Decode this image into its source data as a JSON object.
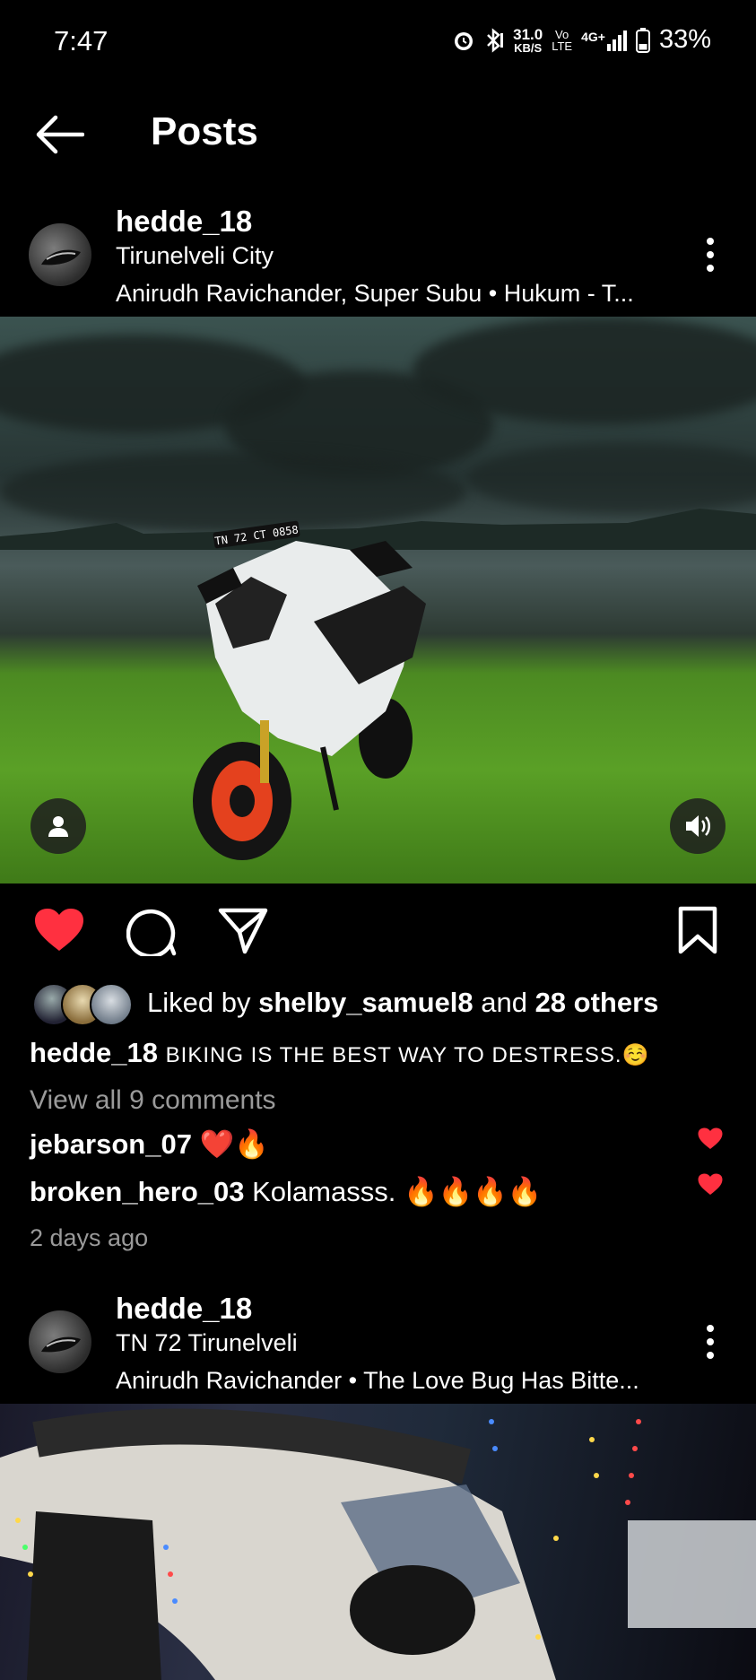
{
  "status": {
    "time": "7:47",
    "speed_value": "31.0",
    "speed_unit": "KB/S",
    "volte_top": "Vo",
    "volte_bottom": "LTE",
    "network": "4G+",
    "battery": "33%"
  },
  "header": {
    "title": "Posts"
  },
  "posts": [
    {
      "username": "hedde_18",
      "location": "Tirunelveli City",
      "audio": "Anirudh Ravichander, Super Subu • Hukum - T...",
      "liked_by_prefix": "Liked by ",
      "liked_by_user": "shelby_samuel8",
      "liked_by_and": " and ",
      "liked_by_others": "28 others",
      "caption_user": "hedde_18",
      "caption_text": "BIKING IS THE BEST WAY TO DESTRESS.☺️",
      "view_comments": "View all 9 comments",
      "comments": [
        {
          "user": "jebarson_07",
          "text": "❤️🔥"
        },
        {
          "user": "broken_hero_03",
          "text": "Kolamasss. 🔥🔥🔥🔥"
        }
      ],
      "time_ago": "2 days ago",
      "plate": "TN 72 CT 0858"
    },
    {
      "username": "hedde_18",
      "location": "TN 72 Tirunelveli",
      "audio": "Anirudh Ravichander • The Love Bug Has Bitte..."
    }
  ],
  "colors": {
    "like_red": "#ff3040",
    "bg": "#000000",
    "muted": "#9a9a9a"
  },
  "icons": [
    "back-arrow-icon",
    "more-vertical-icon",
    "user-tag-icon",
    "volume-icon",
    "heart-icon",
    "comment-icon",
    "share-icon",
    "bookmark-icon"
  ]
}
